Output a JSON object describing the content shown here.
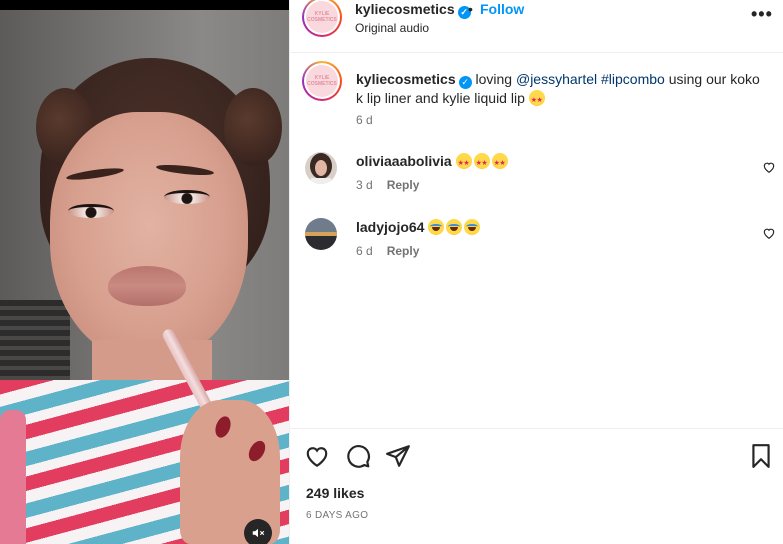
{
  "post": {
    "username": "kyliecosmetics",
    "verified_mark": "✓",
    "dot": "•",
    "follow_label": "Follow",
    "audio_label": "Original audio",
    "more_icon": "more-horizontal-icon",
    "more_label": "•••",
    "avatar_text": "KYLIE COSMETICS"
  },
  "caption": {
    "username": "kyliecosmetics",
    "text_before": "loving ",
    "mention": "@jessyhartel",
    "space": " ",
    "hashtag": "#lipcombo",
    "text_after": " using our koko k lip liner and kylie liquid lip",
    "emoji": "star-struck",
    "age": "6 d"
  },
  "comments": [
    {
      "username": "oliviaaabolivia",
      "emojis": [
        "star-struck",
        "star-struck",
        "star-struck"
      ],
      "age": "3 d",
      "reply_label": "Reply",
      "avatar_style": "portrait-dark-hair"
    },
    {
      "username": "ladyjojo64",
      "emojis": [
        "laughing-tears",
        "laughing-tears",
        "laughing-tears"
      ],
      "age": "6 d",
      "reply_label": "Reply",
      "avatar_style": "sunset-landscape"
    }
  ],
  "actions": {
    "like_icon": "heart-icon",
    "comment_icon": "comment-bubble-icon",
    "share_icon": "paper-plane-icon",
    "save_icon": "bookmark-icon"
  },
  "likes_text": "249 likes",
  "date_text": "6 DAYS AGO",
  "media": {
    "mute_icon": "speaker-muted-icon"
  },
  "colors": {
    "accent": "#0095f6",
    "link": "#00376b",
    "secondary_text": "#737373",
    "border": "#efefef"
  }
}
